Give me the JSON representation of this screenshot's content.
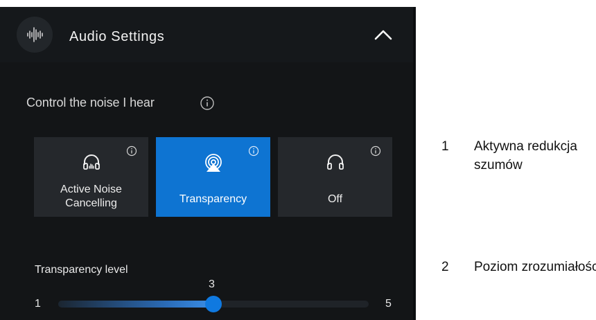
{
  "header": {
    "title": "Audio Settings",
    "icon": "audio-waveform-icon",
    "toggle_icon": "chevron-up-icon"
  },
  "noise_control": {
    "label": "Control the noise I hear",
    "info_icon": "info-icon"
  },
  "modes": [
    {
      "label_lines": [
        "Active Noise",
        "Cancelling"
      ],
      "icon": "headphones-anc-icon",
      "active": false
    },
    {
      "label_lines": [
        "Transparency"
      ],
      "icon": "transparency-icon",
      "active": true
    },
    {
      "label_lines": [
        "Off"
      ],
      "icon": "headphones-icon",
      "active": false
    }
  ],
  "slider": {
    "label": "Transparency level",
    "min": "1",
    "max": "5",
    "value": "3",
    "level": 3
  },
  "legend": [
    {
      "number": "1",
      "text": "Aktywna redukcja szumów"
    },
    {
      "number": "2",
      "text": "Poziom zrozumiałości"
    }
  ],
  "colors": {
    "accent": "#0e74d2",
    "panel_bg": "#131517",
    "tile_bg": "#25282c"
  }
}
